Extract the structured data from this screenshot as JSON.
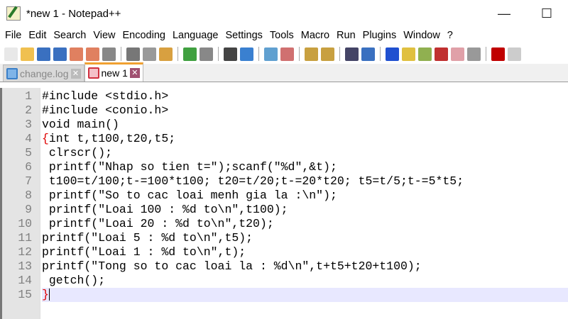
{
  "window": {
    "title": "*new 1 - Notepad++",
    "minimize": "—",
    "maximize": "☐"
  },
  "menu": [
    "File",
    "Edit",
    "Search",
    "View",
    "Encoding",
    "Language",
    "Settings",
    "Tools",
    "Macro",
    "Run",
    "Plugins",
    "Window",
    "?"
  ],
  "toolbar_icons": [
    "new",
    "open",
    "save",
    "save-all",
    "close",
    "close-all",
    "print",
    "cut",
    "copy",
    "paste",
    "undo",
    "redo",
    "find",
    "replace",
    "zoom-in",
    "zoom-out",
    "sync-v",
    "sync-h",
    "word-wrap",
    "show-all-chars",
    "indent-guide",
    "udl",
    "doc-map",
    "function-list",
    "folder-workspace",
    "monitoring",
    "record-macro",
    "stop-record"
  ],
  "tabs": [
    {
      "label": "change.log",
      "active": false,
      "close": "✕"
    },
    {
      "label": "new 1",
      "active": true,
      "close": "✕"
    }
  ],
  "colors": {
    "accent_tab": "#f0a030",
    "brace": "#e00000",
    "current_line": "#e8e8ff"
  },
  "code": {
    "line_numbers": [
      "1",
      "2",
      "3",
      "4",
      "5",
      "6",
      "7",
      "8",
      "9",
      "10",
      "11",
      "12",
      "13",
      "14",
      "15"
    ],
    "lines": [
      "#include <stdio.h>",
      "#include <conio.h>",
      "void main()",
      "int t,t100,t20,t5;",
      " clrscr();",
      " printf(\"Nhap so tien t=\");scanf(\"%d\",&t);",
      " t100=t/100;t-=100*t100; t20=t/20;t-=20*t20; t5=t/5;t-=5*t5;",
      " printf(\"So to cac loai menh gia la :\\n\");",
      " printf(\"Loai 100 : %d to\\n\",t100);",
      " printf(\"Loai 20 : %d to\\n\",t20);",
      "printf(\"Loai 5 : %d to\\n\",t5);",
      "printf(\"Loai 1 : %d to\\n\",t);",
      "printf(\"Tong so to cac loai la : %d\\n\",t+t5+t20+t100);",
      " getch();",
      ""
    ],
    "open_brace": "{",
    "close_brace": "}"
  }
}
